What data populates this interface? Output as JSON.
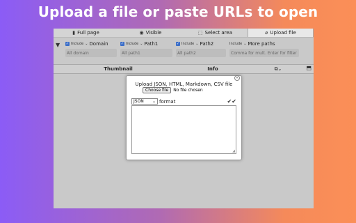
{
  "headline": "Upload a file or paste URLs to open",
  "tabs": [
    {
      "label": "Full page",
      "icon": "page-icon",
      "glyph": "▮"
    },
    {
      "label": "Visible",
      "icon": "eye-icon",
      "glyph": "◉"
    },
    {
      "label": "Select area",
      "icon": "select-area-icon",
      "glyph": "⬚"
    },
    {
      "label": "Upload file",
      "icon": "paperclip-icon",
      "glyph": "⌀"
    }
  ],
  "filters": {
    "funnel_glyph": "▼",
    "include_label": "Include",
    "groups": [
      {
        "label": "Domain",
        "placeholder": "All domain"
      },
      {
        "label": "Path1",
        "placeholder": "All path1"
      },
      {
        "label": "Path2",
        "placeholder": "All path2"
      }
    ],
    "more": {
      "label": "More paths",
      "placeholder": "Comma for mult. Enter for filter"
    }
  },
  "table": {
    "headers": [
      "Thumbnail",
      "Info"
    ],
    "action_glyph": "⧉⌄",
    "corner_glyph": "⬒"
  },
  "modal": {
    "title": "Upload JSON, HTML, Markdown, CSV file",
    "choose_button": "Choose file",
    "no_file": "No file chosen",
    "format_value": "JSON",
    "format_label": "format",
    "check_glyph": "✔✔",
    "close_glyph": "✕"
  }
}
